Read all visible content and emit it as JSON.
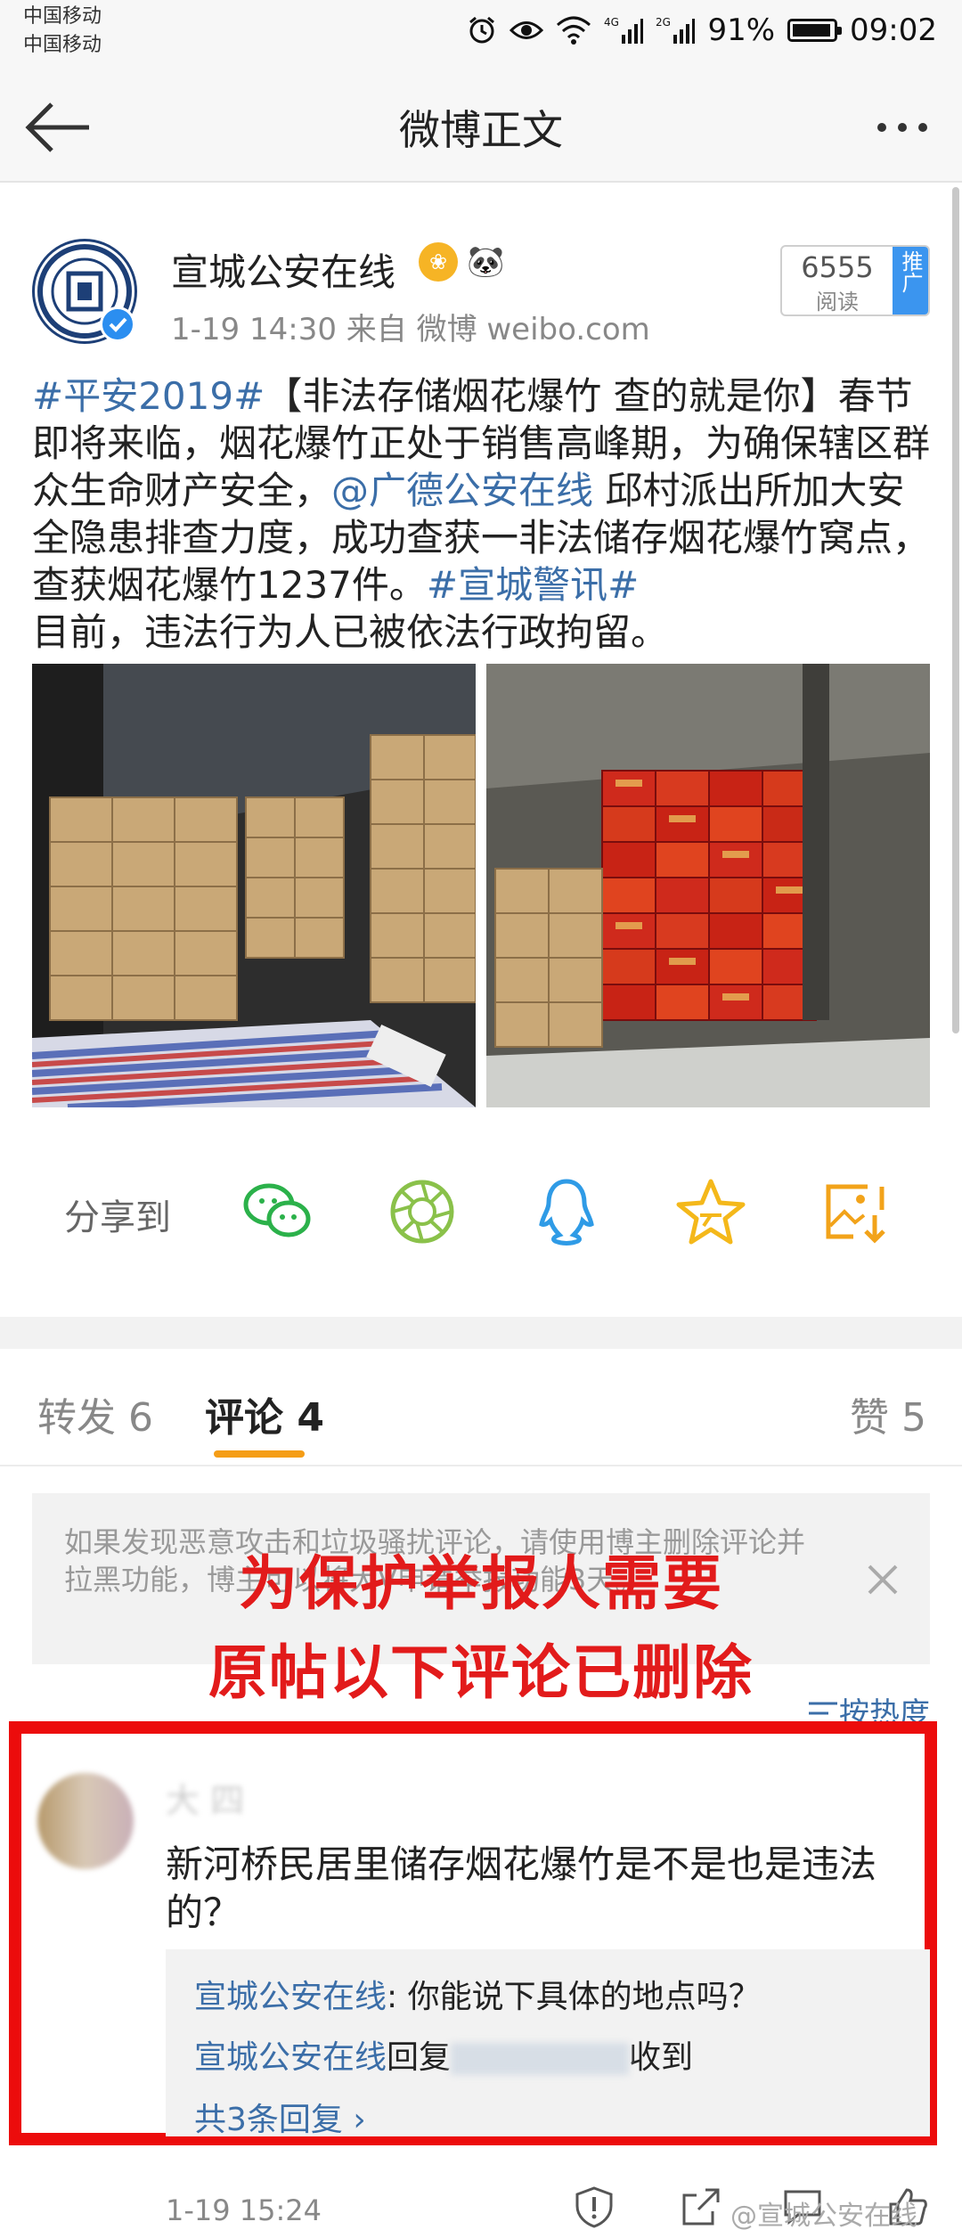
{
  "status_bar": {
    "carrier_1": "中国移动",
    "carrier_2": "中国移动",
    "battery": "91%",
    "time": "09:02"
  },
  "nav": {
    "title": "微博正文"
  },
  "post": {
    "author": "宣城公安在线",
    "meta": "1-19 14:30   来自 微博 weibo.com",
    "read_count": "6555",
    "read_label": "阅读",
    "promote_label": "推广",
    "body": {
      "hashtag_1": "#平安2019#",
      "text_1": "【非法存储烟花爆竹 查的就是你】春节即将来临，烟花爆竹正处于销售高峰期，为确保辖区群众生命财产安全，",
      "mention": "@广德公安在线",
      "text_2": " 邱村派出所加大安全隐患排查力度，成功查获一非法储存烟花爆竹窝点，查获烟花爆竹1237件。",
      "hashtag_2": "#宣城警讯#",
      "text_3": "目前，违法行为人已被依法行政拘留。"
    }
  },
  "share": {
    "label": "分享到"
  },
  "tabs": {
    "repost": "转发 6",
    "comment": "评论 4",
    "like": "赞 5"
  },
  "notice": {
    "text": "如果发现恶意攻击和垃圾骚扰评论，请使用博主删除评论并拉黑功能，博主可以将大V申请举报功能3天。"
  },
  "overlay": {
    "line1": "为保护举报人需要",
    "line2": "原帖以下评论已删除"
  },
  "sort": {
    "label": "按热度"
  },
  "comment": {
    "author": "大 四",
    "text": "新河桥民居里储存烟花爆竹是不是也是违法的？",
    "reply_1_author": "宣城公安在线",
    "reply_1_text": ": 你能说下具体的地点吗？",
    "reply_2_author": "宣城公安在线",
    "reply_2_mid": "回复",
    "reply_2_text": "收到",
    "more_replies": "共3条回复 ›",
    "time": "1-19 15:24"
  },
  "footer": {
    "watermark": "@宣城公安在线"
  },
  "colors": {
    "link": "#3b6ea8",
    "accent": "#f59d16",
    "alert_red": "#e21b1b"
  }
}
